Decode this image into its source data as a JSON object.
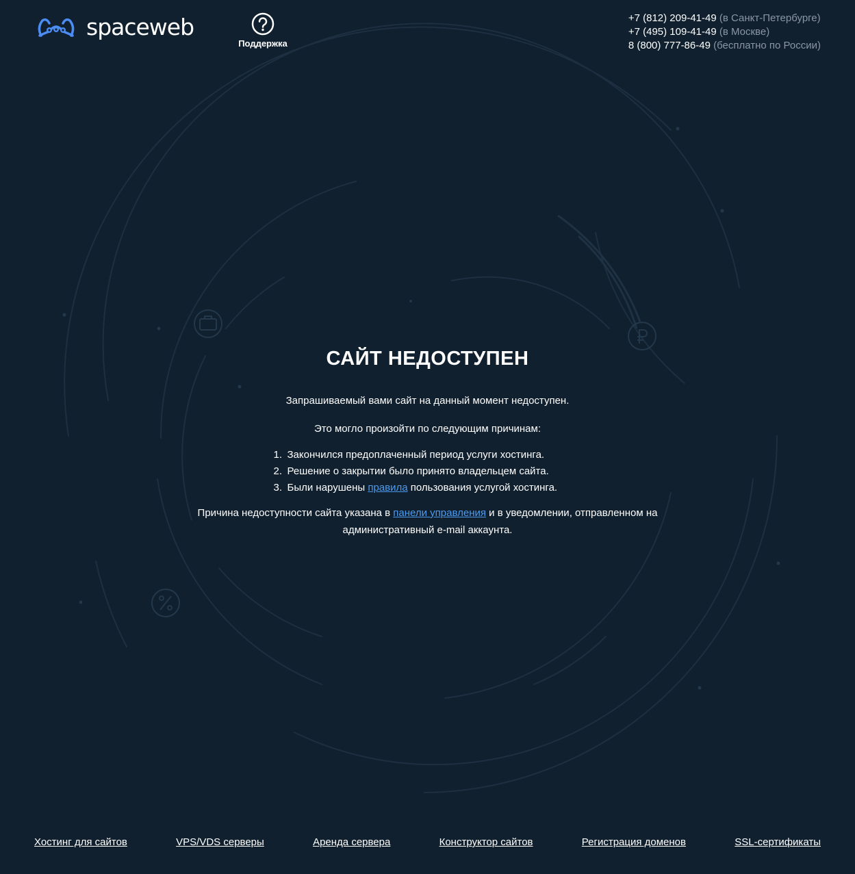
{
  "brand": {
    "name": "spaceweb",
    "accent_color": "#4c8cf5"
  },
  "header": {
    "support_label": "Поддержка",
    "phones": [
      {
        "number": "+7 (812) 209-41-49",
        "note": " (в Санкт-Петербурге)"
      },
      {
        "number": "+7 (495) 109-41-49",
        "note": " (в Москве)"
      },
      {
        "number": "8 (800) 777-86-49",
        "note": " (бесплатно по России)"
      }
    ]
  },
  "main": {
    "title": "САЙТ НЕДОСТУПЕН",
    "intro": "Запрашиваемый вами сайт на данный момент недоступен.",
    "reasons_intro": "Это могло произойти по следующим причинам:",
    "reasons": [
      {
        "num": "1.",
        "text": "Закончился предоплаченный период услуги хостинга."
      },
      {
        "num": "2.",
        "text": "Решение о закрытии было принято владельцем сайта."
      },
      {
        "num": "3.",
        "before": "Были нарушены ",
        "link": "правила",
        "after": " пользования услугой хостинга."
      }
    ],
    "footer_before": "Причина недоступности сайта указана в ",
    "footer_link": "панели управления",
    "footer_after": " и в уведомлении, отправленном на административный e-mail аккаунта.",
    "link_color": "#4c9bf0"
  },
  "footer_nav": [
    "Хостинг для сайтов",
    "VPS/VDS серверы",
    "Аренда сервера",
    "Конструктор сайтов",
    "Регистрация доменов",
    "SSL-сертификаты"
  ],
  "background": {
    "color": "#10202f",
    "orbit_color": "#1f3142",
    "icons": [
      "briefcase-icon",
      "ruble-coin-icon",
      "percent-coin-icon"
    ]
  }
}
